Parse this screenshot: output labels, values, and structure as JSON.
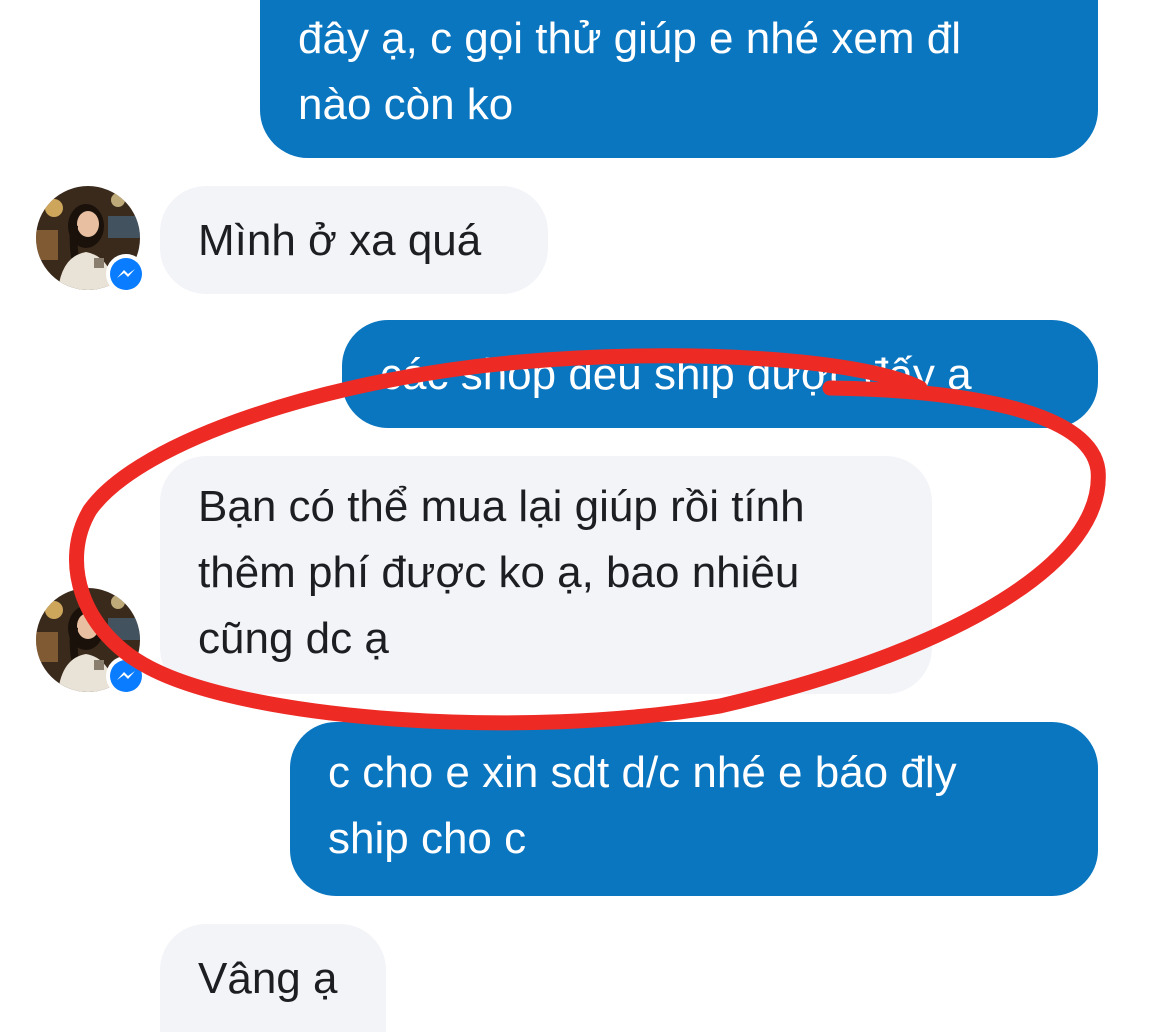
{
  "messages": [
    {
      "sender": "me",
      "text": "đây ạ, c gọi thử giúp e nhé xem đl\nnào còn ko"
    },
    {
      "sender": "contact",
      "text": "Mình ở xa quá"
    },
    {
      "sender": "me",
      "text": "các shop đều ship được đấy ạ"
    },
    {
      "sender": "contact",
      "text": "Bạn có thể mua lại giúp rồi tính\nthêm phí được ko ạ, bao nhiêu\ncũng dc ạ"
    },
    {
      "sender": "me",
      "text": "c cho e xin sdt d/c nhé e báo đly\nship cho c"
    },
    {
      "sender": "contact",
      "text": "Vâng ạ"
    }
  ],
  "colors": {
    "outgoing_bubble": "#0a76c0",
    "incoming_bubble": "#f3f4f8",
    "annotation_stroke": "#ee2a24",
    "messenger_badge": "#0a7cff"
  },
  "icons": {
    "avatar": "contact-profile-photo",
    "badge": "messenger-icon"
  }
}
